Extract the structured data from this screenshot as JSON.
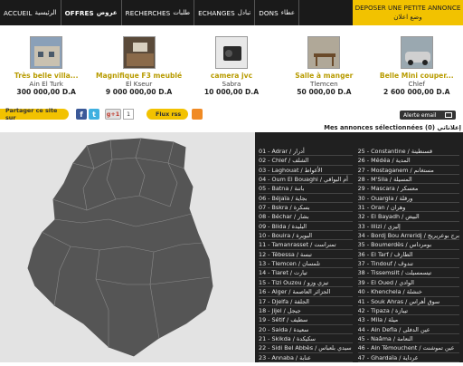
{
  "navbar": {
    "items": [
      {
        "fr": "ACCUEIL",
        "ar": "الرئيسية",
        "active": false
      },
      {
        "fr": "OFFRES",
        "ar": "عروض",
        "active": true
      },
      {
        "fr": "RECHERCHES",
        "ar": "طلبات",
        "active": false
      },
      {
        "fr": "ECHANGES",
        "ar": "تبادل",
        "active": false
      },
      {
        "fr": "DONS",
        "ar": "عطاء",
        "active": false
      }
    ],
    "deposer_fr": "DEPOSER UNE PETITE ANNONCE",
    "deposer_ar": "وضع اعلان"
  },
  "listings": [
    {
      "title": "Très belle villa...",
      "location": "Ain El Turk",
      "price": "300 000,00 D.A"
    },
    {
      "title": "Magnifique F3 meublé",
      "location": "El Kseur",
      "price": "9 000 000,00 D.A"
    },
    {
      "title": "camera jvc",
      "location": "Sabra",
      "price": "10 000,00 D.A"
    },
    {
      "title": "Salle à manger",
      "location": "Tlemcen",
      "price": "50 000,00 D.A"
    },
    {
      "title": "Belle Mini couper...",
      "location": "Chlef",
      "price": "2 600 000,00 D.A"
    }
  ],
  "share": {
    "label": "Partager ce site sur",
    "gplus": "g+1",
    "gplus_count": "1",
    "rss_label": "Flux rss",
    "alert_label": "Alerte email"
  },
  "my_ads": {
    "label": "Mes annonces sélectionnées",
    "label_ar": "إعلاناتي",
    "count": "(0)"
  },
  "wilayas_left": [
    "01 - Adrar / أدرار",
    "02 - Chlef / الشلف",
    "03 - Laghouat / الأغواط",
    "04 - Oum El Bouaghi / أم البواقي",
    "05 - Batna / باتنة",
    "06 - Béjaïa / بجاية",
    "07 - Bskra / بسكرة",
    "08 - Béchar / بشار",
    "09 - Blida / البليدة",
    "10 - Bouira / البويرة",
    "11 - Tamanrasset / تمنراست",
    "12 - Tébessa / تبسة",
    "13 - Tlemcen / تلمسان",
    "14 - Tiaret / تيارت",
    "15 - Tizi Ouzou / تيزي وزو",
    "16 - Alger / الجزائر العاصمة",
    "17 - Djelfa / الجلفة",
    "18 - Jijel / جيجل",
    "19 - Sétif / سطيف",
    "20 - Saida / سعيدة",
    "21 - Skikda / سكيكدة",
    "22 - Sidi Bel Abbès / سيدي بلعباس",
    "23 - Annaba / عنابة"
  ],
  "wilayas_right": [
    "25 - Constantine / قسنطينة",
    "26 - Médéa / المدية",
    "27 - Mostaganem / مستغانم",
    "28 - M'Sila / المسيلة",
    "29 - Mascara / معسكر",
    "30 - Ouargla / ورقلة",
    "31 - Oran / وهران",
    "32 - El Bayadh / البيض",
    "33 - Illizi / إليزي",
    "34 - Bordj Bou Arreridj / برج بوعريريج",
    "35 - Boumerdès / بومرداس",
    "36 - El Tarf / الطارف",
    "37 - Tindouf / تندوف",
    "38 - Tissemsilt / تيسمسيلت",
    "39 - El Oued / الوادي",
    "40 - Khenchela / خنشلة",
    "41 - Souk Ahras / سوق أهراس",
    "42 - Tipaza / تيبازة",
    "43 - Mila / ميلة",
    "44 - Ain Defla / عين الدفلى",
    "45 - Naâma / النعامة",
    "46 - Ain Témouchent / عين تموشنت",
    "47 - Ghardaïa / غرداية"
  ]
}
